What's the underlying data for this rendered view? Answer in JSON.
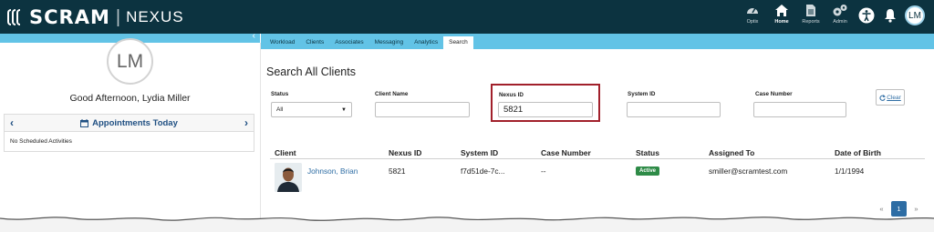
{
  "brand": {
    "name": "SCRAM",
    "separator": "|",
    "product": "NEXUS"
  },
  "topnav": {
    "items": [
      {
        "label": "Optix",
        "icon": "gauge-icon"
      },
      {
        "label": "Home",
        "icon": "home-icon",
        "active": true
      },
      {
        "label": "Reports",
        "icon": "document-icon"
      },
      {
        "label": "Admin",
        "icon": "gears-icon"
      }
    ],
    "accessibility_icon": "accessibility-icon",
    "bell_icon": "bell-icon",
    "user_initials": "LM"
  },
  "sidebar": {
    "avatar_initials": "LM",
    "greeting": "Good Afternoon, Lydia Miller",
    "appointments_title": "Appointments Today",
    "no_activities": "No Scheduled Activities",
    "collapse": "‹",
    "prev": "‹",
    "next": "›"
  },
  "tabs": [
    "Workload",
    "Clients",
    "Associates",
    "Messaging",
    "Analytics",
    "Search"
  ],
  "active_tab": "Search",
  "search": {
    "title": "Search All Clients",
    "status_label": "Status",
    "status_value": "All",
    "client_name_label": "Client Name",
    "client_name_value": "",
    "nexus_id_label": "Nexus ID",
    "nexus_id_value": "5821",
    "system_id_label": "System ID",
    "system_id_value": "",
    "case_number_label": "Case Number",
    "case_number_value": "",
    "clear_label": "Clear"
  },
  "results": {
    "columns": [
      "Client",
      "Nexus ID",
      "System ID",
      "Case Number",
      "Status",
      "Assigned To",
      "Date of Birth"
    ],
    "rows": [
      {
        "client": "Johnson, Brian",
        "nexus_id": "5821",
        "system_id": "f7d51de-7c...",
        "case_number": "--",
        "status": "Active",
        "assigned_to": "smiller@scramtest.com",
        "dob": "1/1/1994"
      }
    ]
  },
  "pagination": {
    "prev": "«",
    "current": "1",
    "next": "»"
  },
  "colors": {
    "topbar": "#0c3340",
    "accent": "#62c3e6",
    "highlight": "#a1202b",
    "active_badge": "#2e8b47",
    "link": "#2e6da4"
  }
}
